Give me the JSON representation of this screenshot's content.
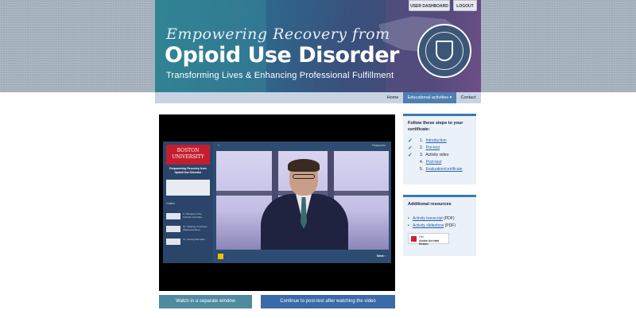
{
  "header": {
    "script_title": "Empowering Recovery from",
    "title": "Opioid Use Disorder",
    "subtitle": "Transforming Lives & Enhancing Professional Fulfillment",
    "user_dashboard_label": "USER DASHBOARD",
    "logout_label": "LOGOUT"
  },
  "nav": {
    "home": "Home",
    "educational": "Educational activities ▾",
    "contact": "Contact"
  },
  "player": {
    "bu_logo": "BOSTON UNIVERSITY",
    "sidebar_title": "Empowering Recovery from Opioid Use Disorder",
    "outline_label": "Outline",
    "items": [
      "9. Changes in the Federal Lanscape",
      "10. Initiating Treatment (Buprenorphine)",
      "11. Closing Remarks"
    ],
    "menu": "≡",
    "resources": "Resources",
    "next_label": "Next ›",
    "accent": "#f0c000"
  },
  "buttons": {
    "separate_window": "Watch in a separate window",
    "post_test": "Continue to post-test after watching the video"
  },
  "steps_card": {
    "title": "Follow these steps to your certificate:",
    "steps": [
      {
        "num": "1.",
        "label": "Introduction",
        "link": true,
        "checked": true
      },
      {
        "num": "2.",
        "label": "Pre-test",
        "link": true,
        "checked": true
      },
      {
        "num": "3.",
        "label": "Activity video",
        "link": false,
        "checked": true
      },
      {
        "num": "4.",
        "label": "Post-test",
        "link": true,
        "checked": false
      },
      {
        "num": "5.",
        "label": "Evaluation/certificate",
        "link": true,
        "checked": false
      }
    ]
  },
  "resources_card": {
    "title": "Additional resources",
    "items": [
      {
        "link": "Activity transcript",
        "suffix": " (PDF)"
      },
      {
        "link": "Activity slideshow",
        "suffix": " (PDF)"
      }
    ],
    "adobe_line1": "Get",
    "adobe_line2": "Adobe Acrobat Reader"
  },
  "colors": {
    "accent_blue": "#3c78b4",
    "teal_button": "#4f8aa0",
    "blue_button": "#3a6aa7",
    "check_color": "#0c7e8a"
  }
}
